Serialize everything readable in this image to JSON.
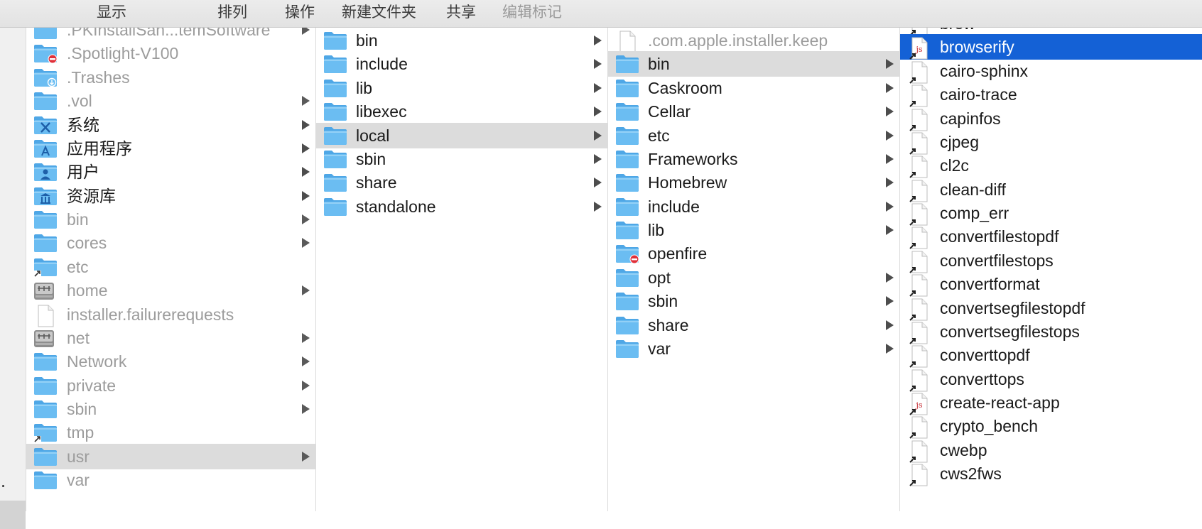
{
  "toolbar": {
    "view": "显示",
    "arrange": "排列",
    "action": "操作",
    "new_folder": "新建文件夹",
    "share": "共享",
    "edit_tags": "编辑标记"
  },
  "colors": {
    "selection": "#1461d6",
    "highlight": "#dcdcdc",
    "folder": "#6bbdf2"
  },
  "columns": [
    {
      "items": [
        {
          "label": ".PKInstallSan...temSoftware",
          "icon": "folder-icon",
          "dim": true,
          "arrow": true
        },
        {
          "label": ".Spotlight-V100",
          "icon": "folder-restricted-icon",
          "dim": true,
          "arrow": false
        },
        {
          "label": ".Trashes",
          "icon": "folder-download-icon",
          "dim": true,
          "arrow": false
        },
        {
          "label": ".vol",
          "icon": "folder-icon",
          "dim": true,
          "arrow": true
        },
        {
          "label": "系统",
          "icon": "system-folder-icon",
          "dim": false,
          "arrow": true
        },
        {
          "label": "应用程序",
          "icon": "applications-folder-icon",
          "dim": false,
          "arrow": true
        },
        {
          "label": "用户",
          "icon": "users-folder-icon",
          "dim": false,
          "arrow": true
        },
        {
          "label": "资源库",
          "icon": "library-folder-icon",
          "dim": false,
          "arrow": true
        },
        {
          "label": "bin",
          "icon": "folder-icon",
          "dim": true,
          "arrow": true
        },
        {
          "label": "cores",
          "icon": "folder-icon",
          "dim": true,
          "arrow": true
        },
        {
          "label": "etc",
          "icon": "folder-alias-icon",
          "dim": true,
          "arrow": false
        },
        {
          "label": "home",
          "icon": "network-drive-icon",
          "dim": true,
          "arrow": true
        },
        {
          "label": "installer.failurerequests",
          "icon": "document-icon",
          "dim": true,
          "arrow": false
        },
        {
          "label": "net",
          "icon": "network-drive-icon",
          "dim": true,
          "arrow": true
        },
        {
          "label": "Network",
          "icon": "folder-icon",
          "dim": true,
          "arrow": true
        },
        {
          "label": "private",
          "icon": "folder-icon",
          "dim": true,
          "arrow": true
        },
        {
          "label": "sbin",
          "icon": "folder-icon",
          "dim": true,
          "arrow": true
        },
        {
          "label": "tmp",
          "icon": "folder-alias-icon",
          "dim": true,
          "arrow": false
        },
        {
          "label": "usr",
          "icon": "folder-icon",
          "dim": true,
          "arrow": true,
          "highlight": true
        },
        {
          "label": "var",
          "icon": "folder-icon",
          "dim": true,
          "arrow": false
        }
      ]
    },
    {
      "items": [
        {
          "label": "bin",
          "icon": "folder-icon",
          "arrow": true
        },
        {
          "label": "include",
          "icon": "folder-icon",
          "arrow": true
        },
        {
          "label": "lib",
          "icon": "folder-icon",
          "arrow": true
        },
        {
          "label": "libexec",
          "icon": "folder-icon",
          "arrow": true
        },
        {
          "label": "local",
          "icon": "folder-icon",
          "arrow": true,
          "highlight": true
        },
        {
          "label": "sbin",
          "icon": "folder-icon",
          "arrow": true
        },
        {
          "label": "share",
          "icon": "folder-icon",
          "arrow": true
        },
        {
          "label": "standalone",
          "icon": "folder-icon",
          "arrow": true
        }
      ]
    },
    {
      "items": [
        {
          "label": ".com.apple.installer.keep",
          "icon": "document-icon",
          "dim": true,
          "arrow": false
        },
        {
          "label": "bin",
          "icon": "folder-icon",
          "arrow": true,
          "highlight": true
        },
        {
          "label": "Caskroom",
          "icon": "folder-icon",
          "arrow": true
        },
        {
          "label": "Cellar",
          "icon": "folder-icon",
          "arrow": true
        },
        {
          "label": "etc",
          "icon": "folder-icon",
          "arrow": true
        },
        {
          "label": "Frameworks",
          "icon": "folder-icon",
          "arrow": true
        },
        {
          "label": "Homebrew",
          "icon": "folder-icon",
          "arrow": true
        },
        {
          "label": "include",
          "icon": "folder-icon",
          "arrow": true
        },
        {
          "label": "lib",
          "icon": "folder-icon",
          "arrow": true
        },
        {
          "label": "openfire",
          "icon": "folder-restricted-icon",
          "arrow": false
        },
        {
          "label": "opt",
          "icon": "folder-icon",
          "arrow": true
        },
        {
          "label": "sbin",
          "icon": "folder-icon",
          "arrow": true
        },
        {
          "label": "share",
          "icon": "folder-icon",
          "arrow": true
        },
        {
          "label": "var",
          "icon": "folder-icon",
          "arrow": true
        }
      ]
    },
    {
      "items": [
        {
          "label": "brew",
          "icon": "alias-document-icon"
        },
        {
          "label": "browserify",
          "icon": "js-document-icon",
          "selected": true
        },
        {
          "label": "cairo-sphinx",
          "icon": "alias-document-icon"
        },
        {
          "label": "cairo-trace",
          "icon": "alias-document-icon"
        },
        {
          "label": "capinfos",
          "icon": "alias-document-icon"
        },
        {
          "label": "cjpeg",
          "icon": "alias-document-icon"
        },
        {
          "label": "cl2c",
          "icon": "alias-document-icon"
        },
        {
          "label": "clean-diff",
          "icon": "alias-document-icon"
        },
        {
          "label": "comp_err",
          "icon": "alias-document-icon"
        },
        {
          "label": "convertfilestopdf",
          "icon": "alias-document-icon"
        },
        {
          "label": "convertfilestops",
          "icon": "alias-document-icon"
        },
        {
          "label": "convertformat",
          "icon": "alias-document-icon"
        },
        {
          "label": "convertsegfilestopdf",
          "icon": "alias-document-icon"
        },
        {
          "label": "convertsegfilestops",
          "icon": "alias-document-icon"
        },
        {
          "label": "converttopdf",
          "icon": "alias-document-icon"
        },
        {
          "label": "converttops",
          "icon": "alias-document-icon"
        },
        {
          "label": "create-react-app",
          "icon": "js-document-icon"
        },
        {
          "label": "crypto_bench",
          "icon": "alias-document-icon"
        },
        {
          "label": "cwebp",
          "icon": "alias-document-icon"
        },
        {
          "label": "cws2fws",
          "icon": "alias-document-icon"
        }
      ]
    }
  ]
}
